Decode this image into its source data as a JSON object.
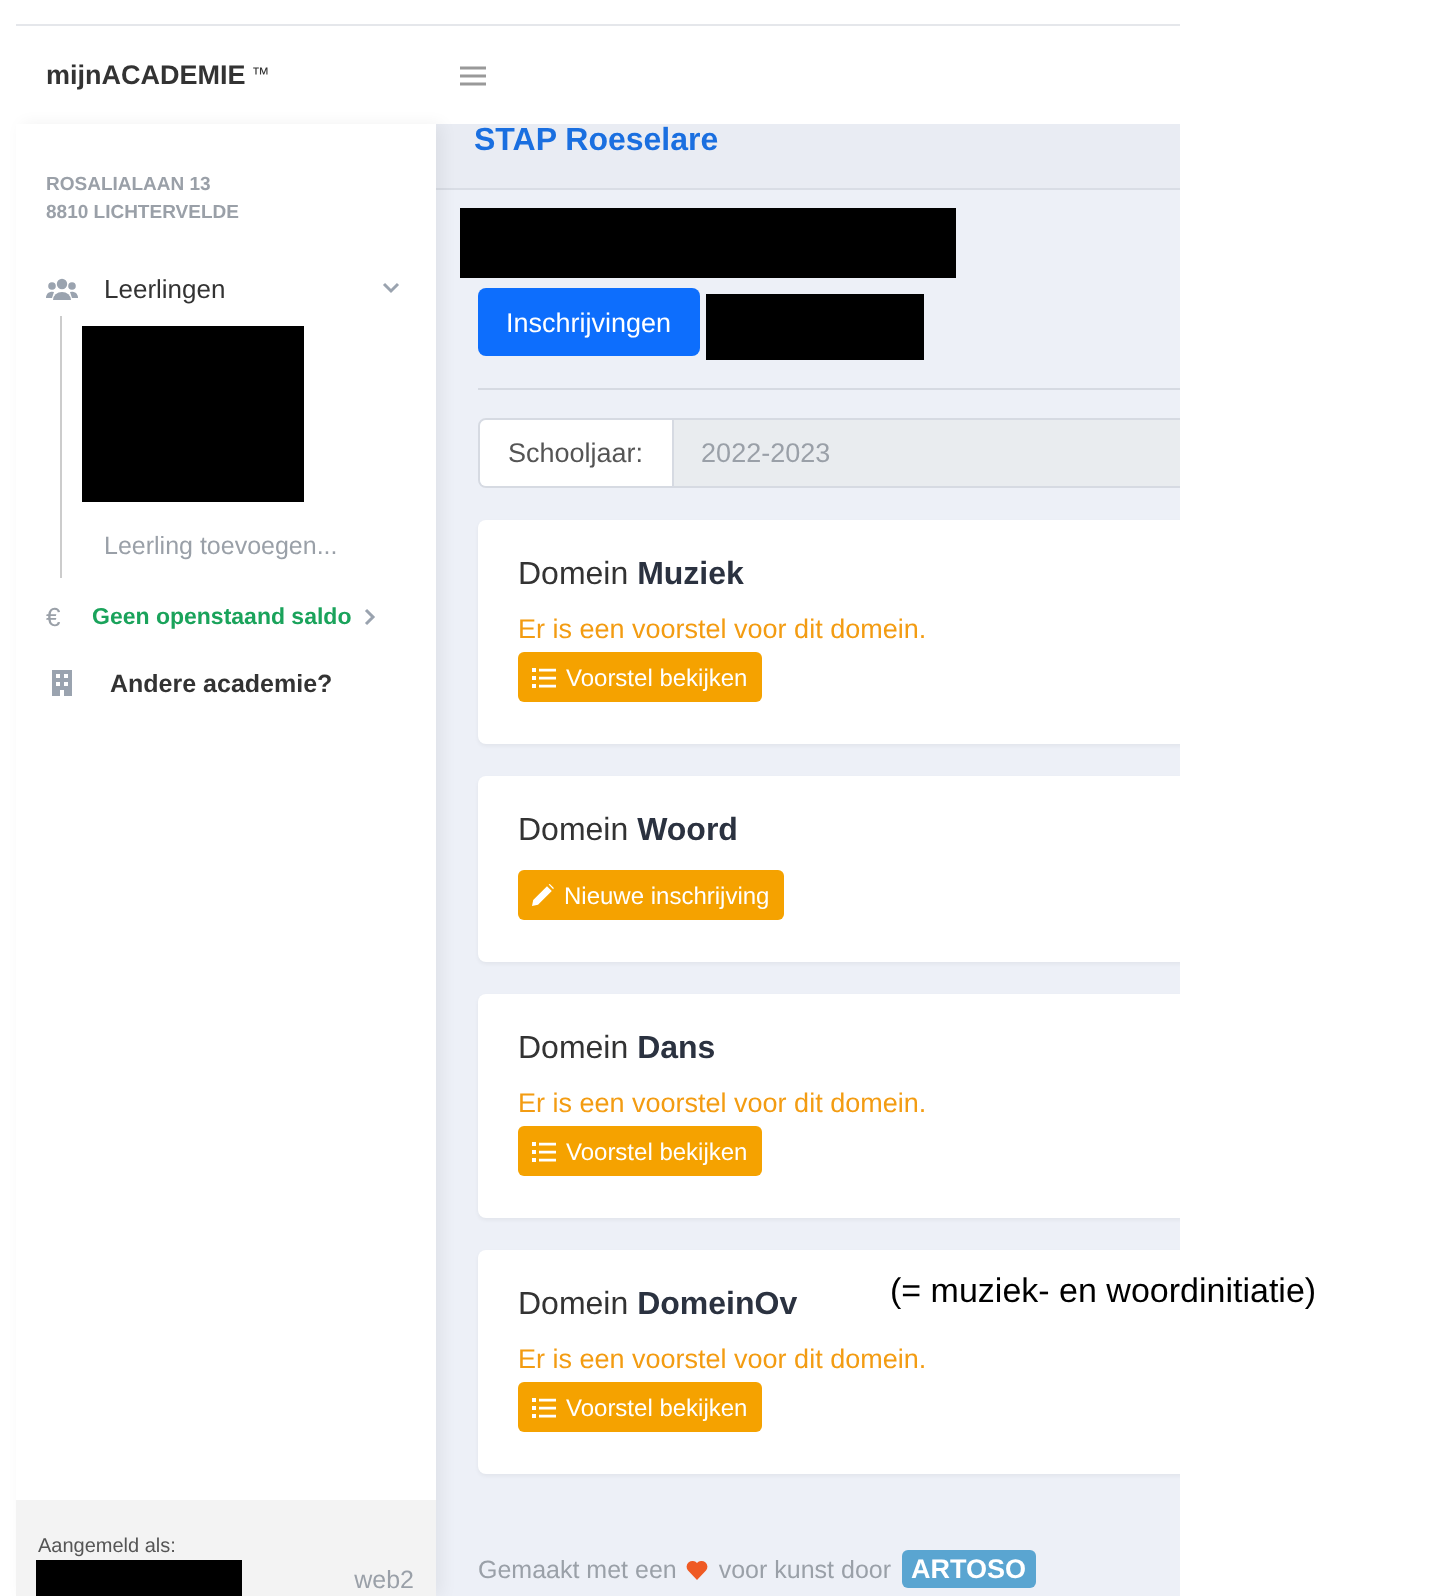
{
  "header": {
    "brand": "mijnACADEMIE",
    "trademark": "™"
  },
  "sidebar": {
    "address": [
      "ROSALIALAAN 13",
      "8810 LICHTERVELDE"
    ],
    "items": [
      {
        "kind": "group",
        "label": "Leerlingen",
        "expanded": true,
        "children": [
          {
            "kind": "hidden"
          },
          {
            "kind": "add",
            "label": "Leerling toevoegen..."
          }
        ]
      },
      {
        "kind": "balance",
        "icon": "€",
        "label": "Geen openstaand saldo"
      },
      {
        "kind": "link",
        "label": "Andere academie?"
      }
    ],
    "footer": {
      "label": "Aangemeld als:",
      "server": "web2"
    }
  },
  "main": {
    "title": "STAP Roeselare",
    "tabs": [
      {
        "label": "Inschrijvingen",
        "selected": true
      }
    ],
    "school_year": {
      "label": "Schooljaar:",
      "value": "2022-2023"
    },
    "domains": [
      {
        "title": "Domein **Muziek**",
        "message": "Er is een voorstel voor dit domein.",
        "action": {
          "kind": "view",
          "label": "Voorstel bekijken"
        }
      },
      {
        "title": "Domein **Woord**",
        "action": {
          "kind": "new",
          "label": "Nieuwe inschrijving"
        }
      },
      {
        "title": "Domein **Dans**",
        "message": "Er is een voorstel voor dit domein.",
        "action": {
          "kind": "view",
          "label": "Voorstel bekijken"
        }
      },
      {
        "title": "Domein **DomeinOv**",
        "message": "Er is een voorstel voor dit domein.",
        "action": {
          "kind": "view",
          "label": "Voorstel bekijken"
        }
      }
    ],
    "footer": {
      "before": "Gemaakt met een",
      "after": "voor kunst door",
      "brand": "ARTOSO"
    }
  },
  "annotation": "(= muziek- en woordinitiatie)"
}
